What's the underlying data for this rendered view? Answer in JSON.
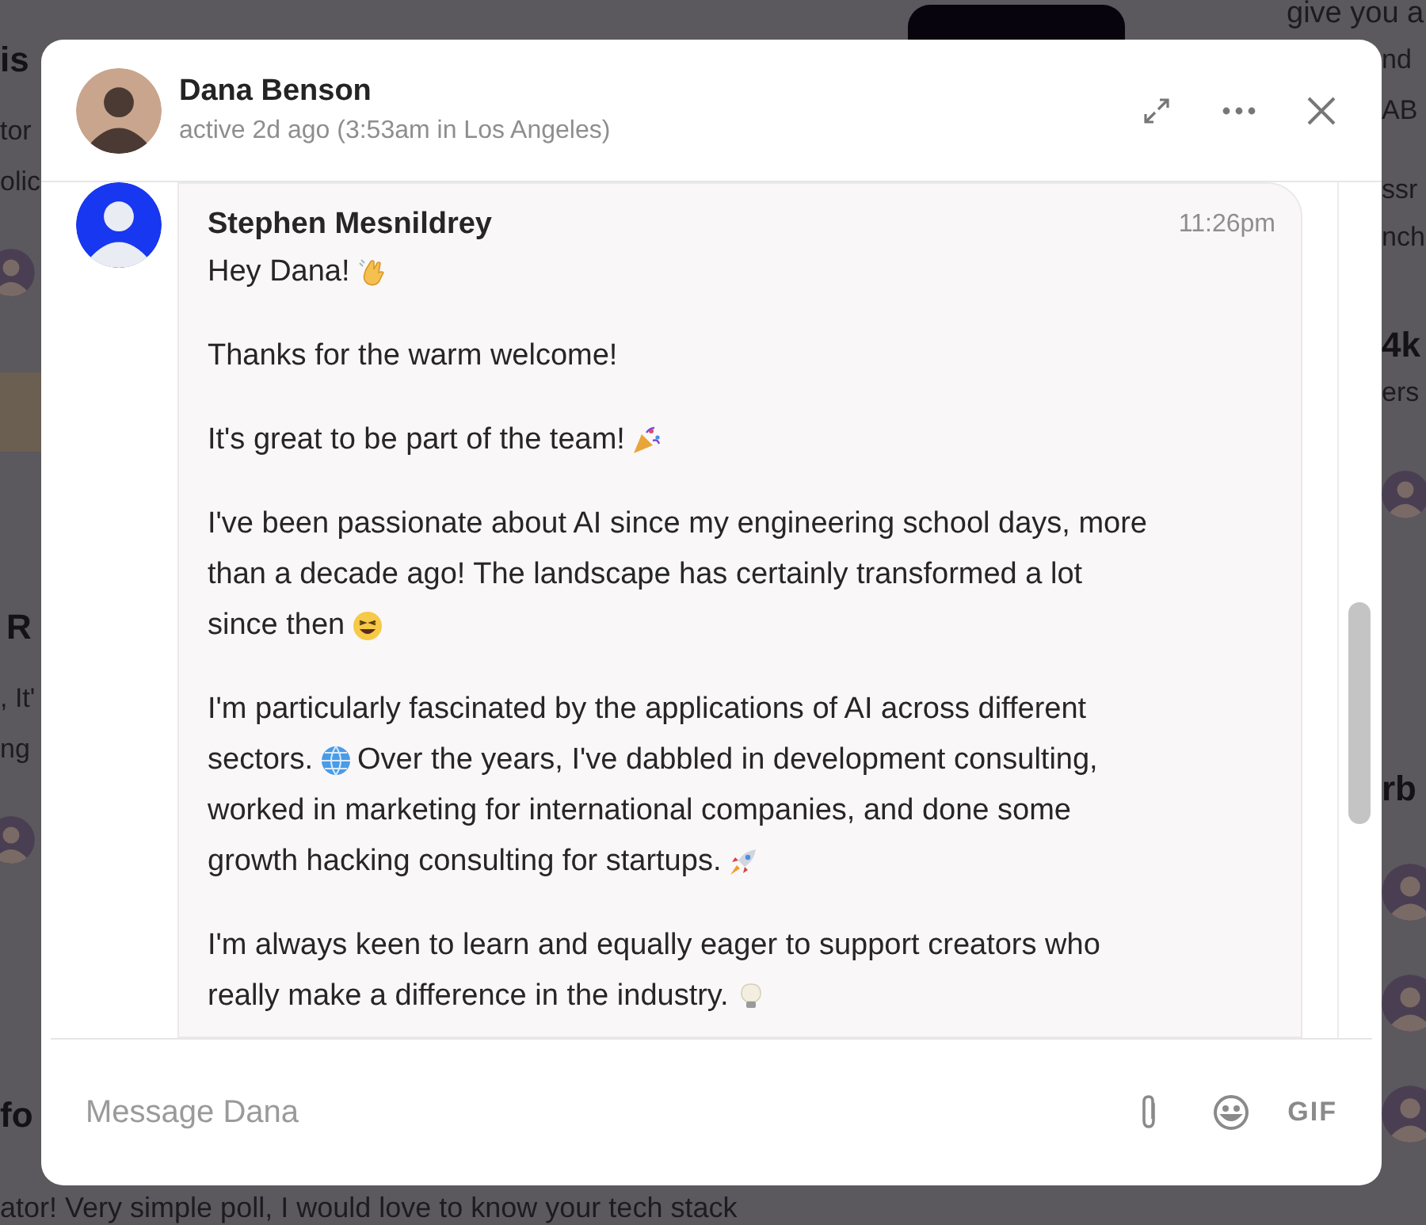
{
  "background": {
    "top_text": "give you a",
    "left": [
      "is",
      "tor",
      "olic",
      "R",
      ", It'",
      "ng",
      "fo"
    ],
    "right": [
      "nd",
      "AB",
      "ssr",
      "nch",
      "4k",
      "ers",
      "rb"
    ],
    "bottom_text": "ator! Very simple poll, I would love to know your tech stack"
  },
  "dialog": {
    "contact": {
      "name": "Dana Benson",
      "status": "active 2d ago (3:53am in Los Angeles)"
    },
    "message": {
      "author": "Stephen Mesnildrey",
      "time": "11:26pm",
      "paragraphs": [
        {
          "lines": [
            [
              {
                "kind": "text",
                "text": "Hey Dana!"
              },
              {
                "kind": "wave"
              }
            ]
          ]
        },
        {
          "lines": [
            [
              {
                "kind": "text",
                "text": "Thanks for the warm welcome!"
              }
            ]
          ]
        },
        {
          "lines": [
            [
              {
                "kind": "text",
                "text": "It's great to be part of the team!"
              },
              {
                "kind": "party"
              }
            ]
          ]
        },
        {
          "lines": [
            [
              {
                "kind": "text",
                "text": "I've been passionate about AI since my engineering school days, more"
              }
            ],
            [
              {
                "kind": "text",
                "text": "than a decade ago! The landscape has certainly transformed a lot"
              }
            ],
            [
              {
                "kind": "text",
                "text": "since then"
              },
              {
                "kind": "grin"
              }
            ]
          ]
        },
        {
          "lines": [
            [
              {
                "kind": "text",
                "text": "I'm particularly fascinated by the applications of AI across different"
              }
            ],
            [
              {
                "kind": "text",
                "text": "sectors."
              },
              {
                "kind": "globe"
              },
              {
                "kind": "text",
                "text": "Over the years, I've dabbled in development consulting,"
              }
            ],
            [
              {
                "kind": "text",
                "text": "worked in marketing for international companies, and done some"
              }
            ],
            [
              {
                "kind": "text",
                "text": "growth hacking consulting for startups."
              },
              {
                "kind": "rocket"
              }
            ]
          ]
        },
        {
          "lines": [
            [
              {
                "kind": "text",
                "text": "I'm always keen to learn and equally eager to support creators who"
              }
            ],
            [
              {
                "kind": "text",
                "text": "really make a difference in the industry."
              },
              {
                "kind": "bulb"
              }
            ]
          ]
        }
      ]
    },
    "composer": {
      "placeholder": "Message Dana",
      "gif_label": "GIF"
    }
  }
}
